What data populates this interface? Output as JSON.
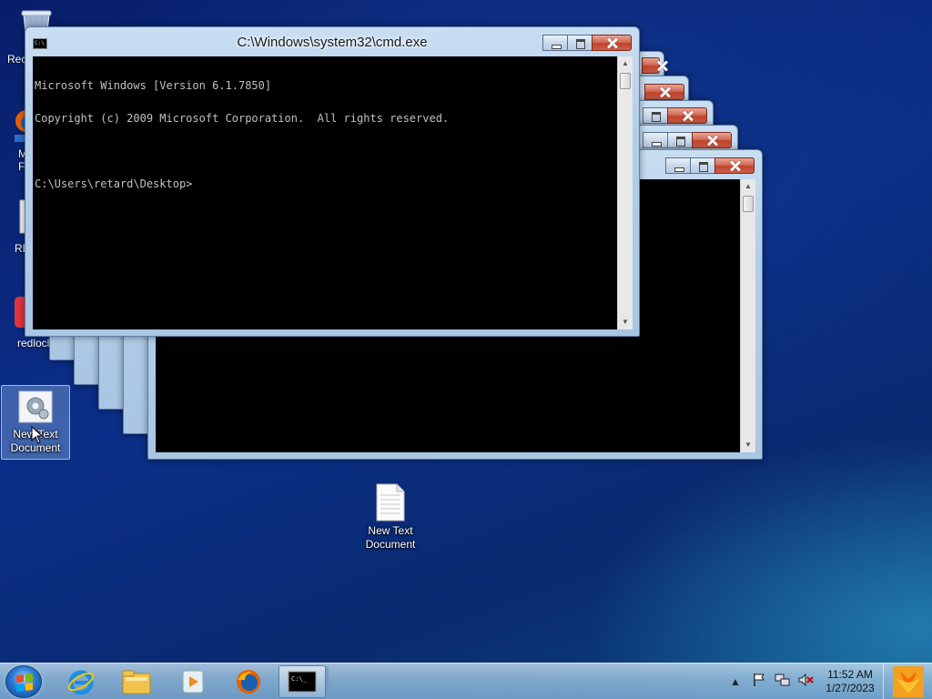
{
  "desktop": {
    "icons": [
      {
        "label": "Rec"
      },
      {
        "label": "M\nF"
      },
      {
        "label": "RE"
      },
      {
        "label": "redlocl"
      },
      {
        "label": "New Text Document"
      },
      {
        "label": "New Text Document"
      }
    ]
  },
  "main_window": {
    "title": "C:\\Windows\\system32\\cmd.exe",
    "console_lines": [
      "Microsoft Windows [Version 6.1.7850]",
      "Copyright (c) 2009 Microsoft Corporation.  All rights reserved.",
      "",
      "C:\\Users\\retard\\Desktop>"
    ]
  },
  "taskbar": {
    "pinned": [
      "internet-explorer-icon",
      "windows-explorer-icon",
      "media-player-icon",
      "firefox-icon",
      "cmd-icon"
    ],
    "clock": {
      "time": "11:52 AM",
      "date": "1/27/2023"
    }
  },
  "colors": {
    "console_bg": "#000000",
    "console_text": "#c0c0c0",
    "close_button": "#c0432a"
  }
}
